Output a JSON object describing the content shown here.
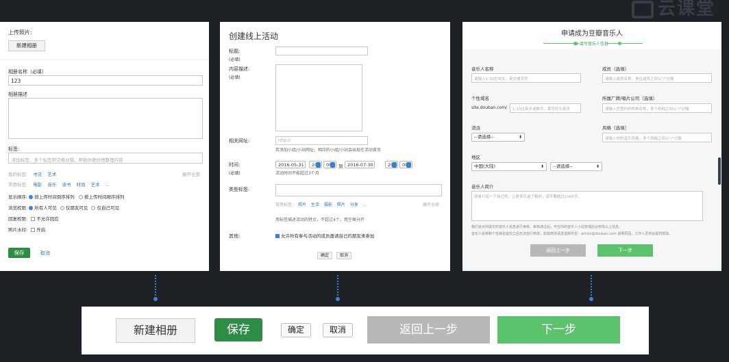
{
  "logo": {
    "text": "云课堂"
  },
  "p1": {
    "upload_label": "上传照片:",
    "new_album": "新建相册",
    "album_name_label": "相册名称（必填）",
    "album_name_value": "123",
    "album_desc_label": "相册描述",
    "tags_label": "标签:",
    "tags_placeholder": "添加标签、多个标签用空格分隔、帮助你更好地整理内容",
    "my_tags_label": "我的标签:",
    "my_tags": [
      "书法",
      "艺术"
    ],
    "expand_all": "展开全部",
    "common_tags_label": "常用标签:",
    "common_tags": [
      "电影",
      "音乐",
      "读书",
      "时尚",
      "艺术",
      "..."
    ],
    "order_label": "显示顺序:",
    "order_opt1": "按上传时间倒序排列",
    "order_opt2": "按上传时间顺序排列",
    "view_label": "浏览权限:",
    "view_opt1": "所有人可见",
    "view_opt2": "仅朋友可见",
    "view_opt3": "仅自己可见",
    "reply_label": "回复权限:",
    "reply_opt": "不允许回应",
    "watermark_label": "照片水印:",
    "watermark_opt": "开启",
    "save": "保存",
    "cancel": "取消"
  },
  "p2": {
    "title": "创建线上活动",
    "title_label": "标题:",
    "required": "(必填)",
    "content_label": "内容描述:",
    "url_label": "相关网址:",
    "url_placeholder": "http://",
    "url_hint": "若添加小组/小站网址，相应的小组/小站会出现在活动首页",
    "time_label": "时间:",
    "start_date": "2016-05-31",
    "start_hour": "20",
    "start_min": "00",
    "to": "到",
    "end_date": "2016-07-30",
    "end_hour": "20",
    "end_min": "00",
    "time_hint": "活动时间不能超过3个月",
    "type_label": "类型标签:",
    "common_label": "常用标签:",
    "common_tags": [
      "照片",
      "生活",
      "摄影",
      "照片",
      "分享",
      "..."
    ],
    "expand_all": "展开全部",
    "type_hint": "用标签描述活动的特点，不超过4个，用空格分开",
    "other_label": "其他:",
    "other_opt": "允许所有参与活动的成员邀请自己的朋友来参加",
    "ok": "确定",
    "cancel": "取消"
  },
  "p3": {
    "title": "申请成为豆瓣音乐人",
    "step": "2.填写音乐人信息",
    "musician_name_label": "音乐人名称",
    "musician_name_ph": "请输入1-30位中文、英文或字符",
    "members_label": "成员（选填）",
    "members_ph": "请输入成员名称，多位成员之间以\"/\"分隔",
    "domain_label": "个性域名",
    "domain_prefix": "site.douban.com/",
    "domain_ph": "1-15位英文或数字，首字符为英文",
    "label_label": "所属厂牌/唱片公司（选填）",
    "label_ph": "请输入您签约的机构名称，多个机构之间以\"/\"分隔",
    "genre_label": "流派",
    "genre_sel": "--请选择--",
    "style_label": "风格（选填）",
    "style_ph": "请输入你的音乐风格，多个风格之间以\"/\"分隔",
    "region_label": "地区",
    "region_sel1": "中国(大陆)",
    "region_sel2": "--请选择--",
    "intro_label": "音乐人简介",
    "intro_ph": "简单介绍一下自己吧，让更多乐迷了解你，请不要超过1000字。",
    "note1": "我们会对你提交的音乐人信息进行审核，审核通过后，可在你的音乐人小站管理后台修改以上信息。",
    "note2": "音乐人名称和个性域名提交之后无法自行修改，如需修改请发送邮件至：artists@douban.com 说明原因，工作人员将会提供帮助。",
    "back": "返回上一步",
    "next": "下一步"
  },
  "bottom": {
    "new_album": "新建相册",
    "save": "保存",
    "ok": "确定",
    "cancel": "取消",
    "back": "返回上一步",
    "next": "下一步"
  }
}
